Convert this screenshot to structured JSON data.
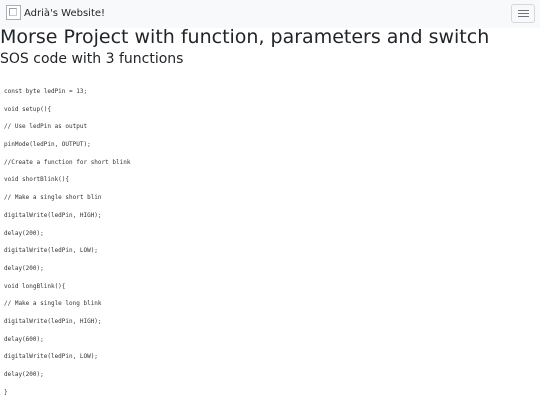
{
  "navbar": {
    "brand_name": "Adrià's Website!",
    "logo_icon": "broken-image-icon",
    "menu_icon": "hamburger-menu-icon"
  },
  "page": {
    "title": "Morse Project with function, parameters and switch",
    "subtitle": "SOS code with 3 functions"
  },
  "code_lines": [
    "const byte ledPin = 13;",
    "void setup(){",
    "// Use ledPin as output",
    "pinMode(ledPin, OUTPUT);",
    "//Create a function for short blink",
    "void shortBlink(){",
    "// Make a single short blin",
    "digitalWrite(ledPin, HIGH);",
    "delay(200);",
    "digitalWrite(ledPin, LOW);",
    "delay(200);",
    "void longBlink(){",
    "// Make a single long blink",
    "digitalWrite(ledPin, HIGH);",
    "delay(600);",
    "digitalWrite(ledPin, LOW);",
    "delay(200);",
    "}"
  ]
}
